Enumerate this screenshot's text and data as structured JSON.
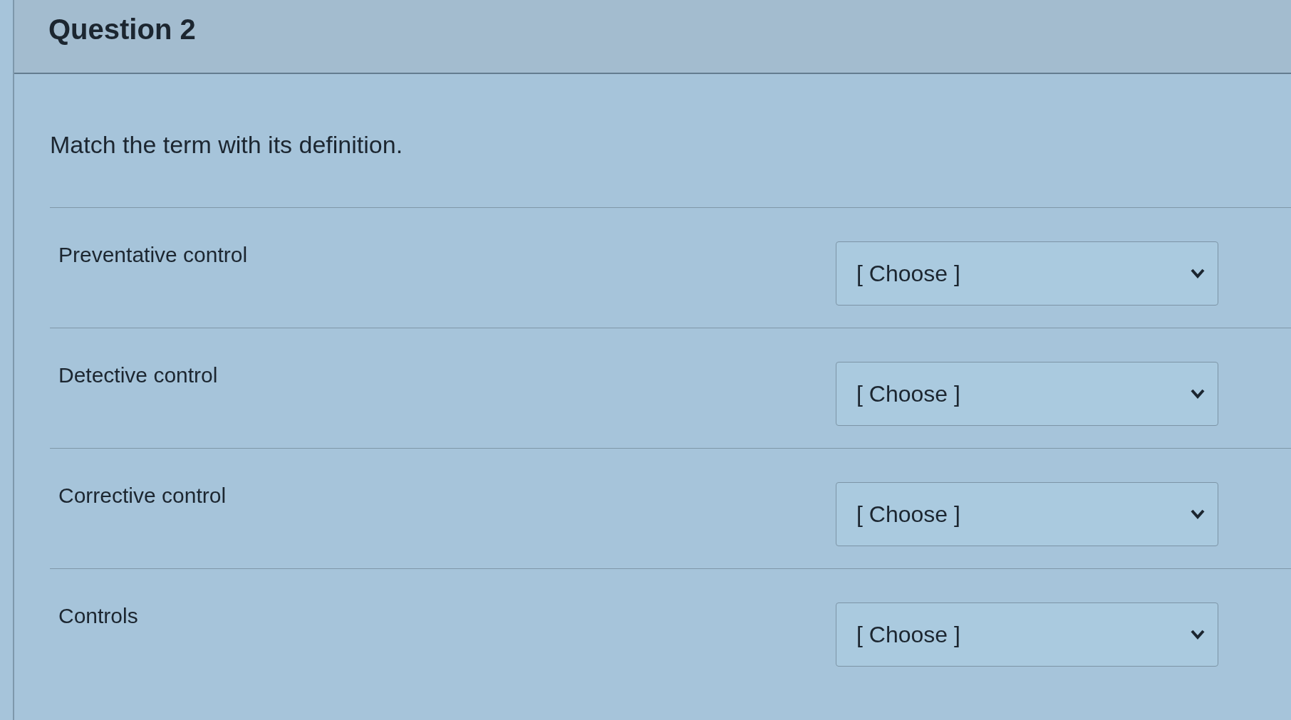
{
  "question": {
    "title": "Question 2",
    "prompt": "Match the term with its definition.",
    "pairs": [
      {
        "term": "Preventative control",
        "answer": "[ Choose ]"
      },
      {
        "term": "Detective control",
        "answer": "[ Choose ]"
      },
      {
        "term": "Corrective control",
        "answer": "[ Choose ]"
      },
      {
        "term": "Controls",
        "answer": "[ Choose ]"
      }
    ]
  }
}
